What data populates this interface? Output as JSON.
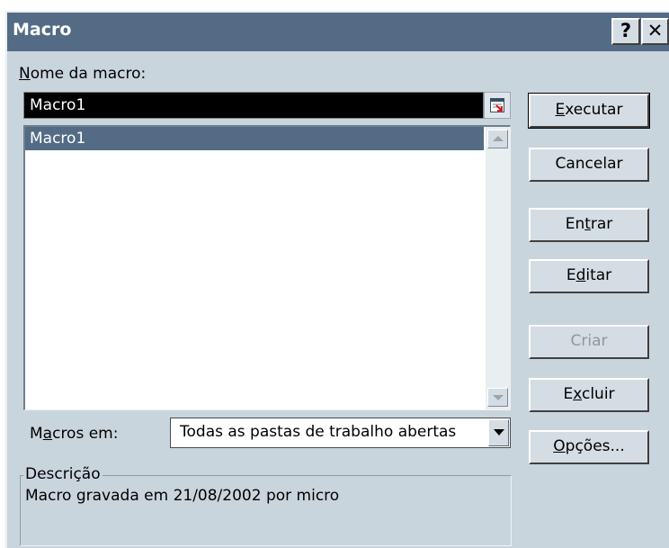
{
  "window": {
    "title": "Macro",
    "help_label": "?",
    "close_label": "✕"
  },
  "macro_name": {
    "label_accel": "N",
    "label_rest": "ome da macro:",
    "value": "Macro1"
  },
  "macro_list": {
    "items": [
      "Macro1"
    ],
    "selected_index": 0
  },
  "macros_in": {
    "label_pre": "M",
    "label_accel": "a",
    "label_post": "cros em:",
    "value": "Todas as pastas de trabalho abertas"
  },
  "description": {
    "legend": "Descrição",
    "text": "Macro gravada em 21/08/2002 por micro"
  },
  "buttons": {
    "executar": {
      "pre": "",
      "accel": "E",
      "post": "xecutar"
    },
    "cancelar": {
      "pre": "Cancelar",
      "accel": "",
      "post": ""
    },
    "entrar": {
      "pre": "En",
      "accel": "t",
      "post": "rar"
    },
    "editar": {
      "pre": "E",
      "accel": "d",
      "post": "itar"
    },
    "criar": {
      "pre": "Criar",
      "accel": "",
      "post": ""
    },
    "excluir": {
      "pre": "E",
      "accel": "x",
      "post": "cluir"
    },
    "opcoes": {
      "pre": "",
      "accel": "O",
      "post": "pções..."
    }
  },
  "colors": {
    "titlebar": "#536b84",
    "dialog_bg": "#c9d5dd",
    "selection": "#536b84",
    "disabled_text": "#8c98a2"
  }
}
